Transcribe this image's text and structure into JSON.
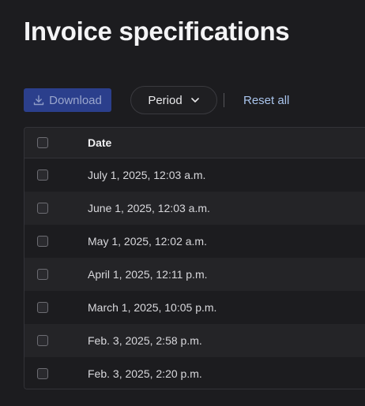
{
  "page": {
    "title": "Invoice specifications"
  },
  "toolbar": {
    "download_label": "Download",
    "download_icon": "download-icon",
    "period_label": "Period",
    "period_icon": "chevron-down-icon",
    "reset_label": "Reset all"
  },
  "table": {
    "columns": [
      "Date"
    ],
    "rows": [
      {
        "date": "July 1, 2025, 12:03 a.m."
      },
      {
        "date": "June 1, 2025, 12:03 a.m."
      },
      {
        "date": "May 1, 2025, 12:02 a.m."
      },
      {
        "date": "April 1, 2025, 12:11 p.m."
      },
      {
        "date": "March 1, 2025, 10:05 p.m."
      },
      {
        "date": "Feb. 3, 2025, 2:58 p.m."
      },
      {
        "date": "Feb. 3, 2025, 2:20 p.m."
      }
    ]
  },
  "colors": {
    "background": "#1c1c1f",
    "accent": "#2b3f8c",
    "link": "#a9c4ec"
  }
}
